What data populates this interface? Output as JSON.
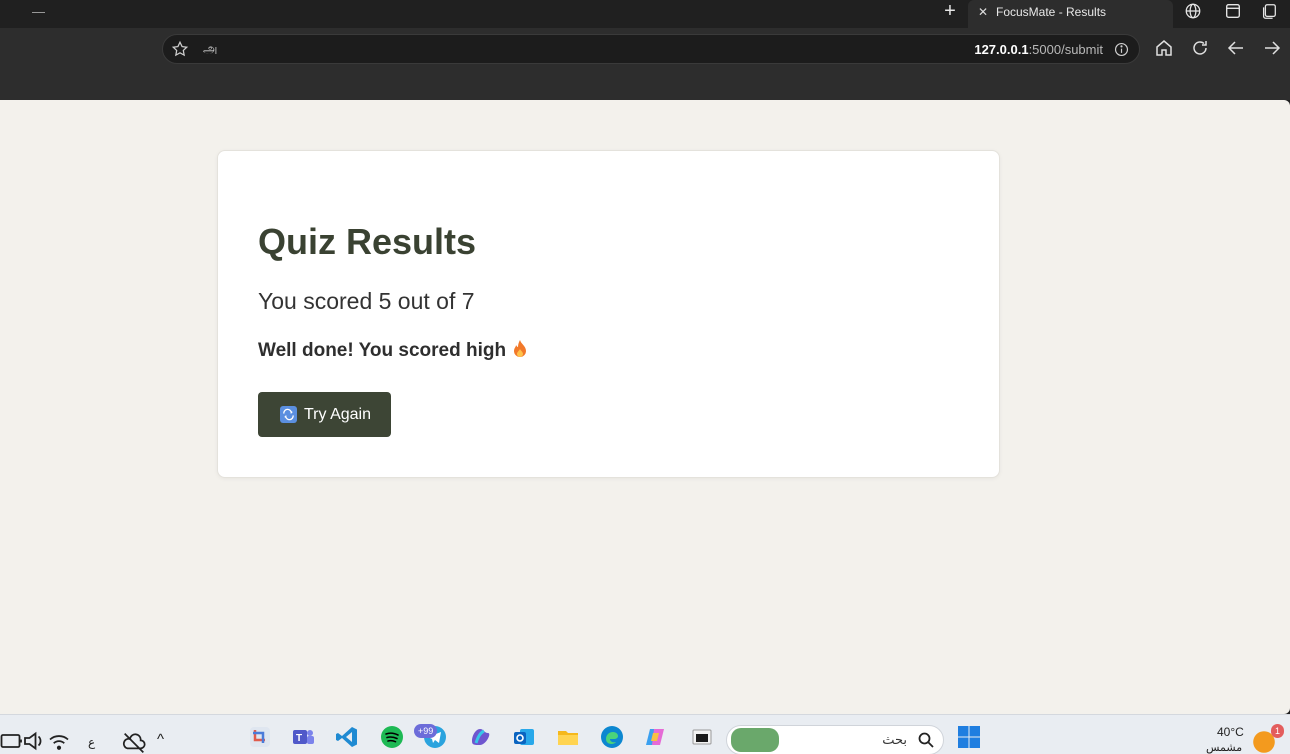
{
  "browser": {
    "tab_title": "FocusMate - Results",
    "address_lang": "அ",
    "url_host": "127.0.0.1",
    "url_path": ":5000/submit"
  },
  "page": {
    "heading": "Quiz Results",
    "score_text": "You scored 5 out of 7",
    "message": "Well done! You scored high",
    "try_again_label": "Try Again"
  },
  "taskbar": {
    "keyboard_lang": "ع",
    "search_placeholder": "بحث",
    "telegram_badge": "+99",
    "weather_temp": "40°C",
    "weather_desc": "مشمس",
    "notification_count": "1"
  },
  "colors": {
    "page_bg": "#f3f1ec",
    "heading": "#3a4232",
    "button_bg": "#3d4535"
  }
}
